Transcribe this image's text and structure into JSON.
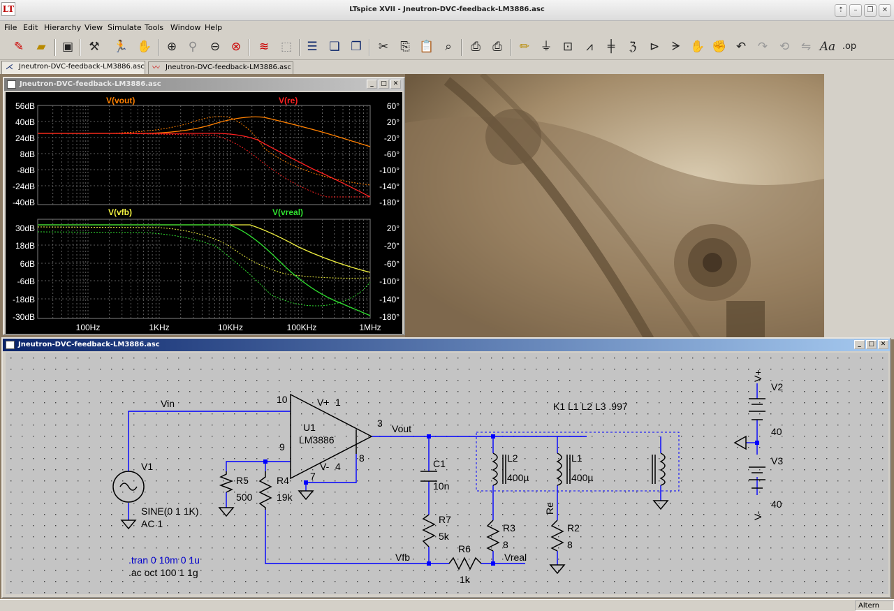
{
  "app": {
    "title": "LTspice XVII - Jneutron-DVC-feedback-LM3886.asc",
    "logo_text": "LT"
  },
  "menu": [
    "File",
    "Edit",
    "Hierarchy",
    "View",
    "Simulate",
    "Tools",
    "Window",
    "Help"
  ],
  "toolbar_icons": [
    "new-schematic-icon",
    "open-icon",
    "save-icon",
    "control-panel-icon",
    "run-icon",
    "halt-icon",
    "zoom-in-icon",
    "zoom-pan-icon",
    "zoom-out-icon",
    "zoom-fit-icon",
    "autorange-icon",
    "cursor-icon",
    "tile-horizontal-icon",
    "cascade-icon",
    "tile-vertical-icon",
    "cut-icon",
    "copy-icon",
    "paste-icon",
    "find-icon",
    "print-preview-icon",
    "print-icon",
    "draw-wire-icon",
    "ground-icon",
    "net-label-icon",
    "resistor-icon",
    "capacitor-icon",
    "inductor-icon",
    "diode-icon",
    "component-icon",
    "move-icon",
    "drag-icon",
    "undo-icon",
    "redo-icon",
    "rotate-icon",
    "mirror-icon",
    "text-icon",
    "spice-directive-icon"
  ],
  "tabs": [
    {
      "label": "Jneutron-DVC-feedback-LM3886.asc",
      "icon": "schematic-tab-icon",
      "active": true
    },
    {
      "label": "Jneutron-DVC-feedback-LM3886.asc",
      "icon": "waveform-tab-icon",
      "active": false
    }
  ],
  "waveform_window": {
    "title": "Jneutron-DVC-feedback-LM3886.asc",
    "panes": [
      {
        "traces": [
          {
            "name": "V(vout)",
            "color": "#ff8000"
          },
          {
            "name": "V(re)",
            "color": "#ff2020"
          }
        ],
        "left_ticks": [
          "56dB",
          "40dB",
          "24dB",
          "8dB",
          "-8dB",
          "-24dB",
          "-40dB"
        ],
        "right_ticks": [
          "60°",
          "20°",
          "-20°",
          "-60°",
          "-100°",
          "-140°",
          "-180°"
        ]
      },
      {
        "traces": [
          {
            "name": "V(vfb)",
            "color": "#f0f040"
          },
          {
            "name": "V(vreal)",
            "color": "#30e030"
          }
        ],
        "left_ticks": [
          "30dB",
          "18dB",
          "6dB",
          "-6dB",
          "-18dB",
          "-30dB"
        ],
        "right_ticks": [
          "20°",
          "-20°",
          "-60°",
          "-100°",
          "-140°",
          "-180°"
        ]
      }
    ],
    "x_ticks": [
      "100Hz",
      "1KHz",
      "10KHz",
      "100KHz",
      "1MHz"
    ]
  },
  "schematic_window": {
    "title": "Jneutron-DVC-feedback-LM3886.asc",
    "labels": {
      "vin": "Vin",
      "vout": "Vout",
      "vfb": "Vfb",
      "vreal": "Vreal",
      "re": "Re",
      "vplus": "V+",
      "vminus": "V-",
      "u1": "U1",
      "u1_model": "LM3886",
      "pin10": "10",
      "pin1": "1",
      "pin3": "3",
      "pin9": "9",
      "pin8": "8",
      "pin7": "7",
      "opamp_vplus": "V+",
      "opamp_vminus": "V-",
      "pin4": "4",
      "v1": "V1",
      "v1_func": "SINE(0 1 1K)",
      "v1_ac": "AC 1",
      "r5": "R5",
      "r5_val": "500",
      "r4": "R4",
      "r4_val": "19k",
      "c1": "C1",
      "c1_val": "10n",
      "r7": "R7",
      "r7_val": "5k",
      "r6": "R6",
      "r6_val": "1k",
      "r3": "R3",
      "r3_val": "8",
      "r2": "R2",
      "r2_val": "8",
      "l2": "L2",
      "l2_val": "400µ",
      "l1": "L1",
      "l1_val": "400µ",
      "coupling": "K1 L1 L2 L3 .997",
      "v2": "V2",
      "v2_val": "40",
      "v3": "V3",
      "v3_val": "40",
      "tran": ".tran 0 10m 0 1u",
      "ac": ".ac oct 100 1 1g"
    },
    "wire_color": "#0000ff",
    "component_color": "#000000",
    "directive_color": "#0000cc"
  },
  "status": {
    "text": "Altern"
  }
}
